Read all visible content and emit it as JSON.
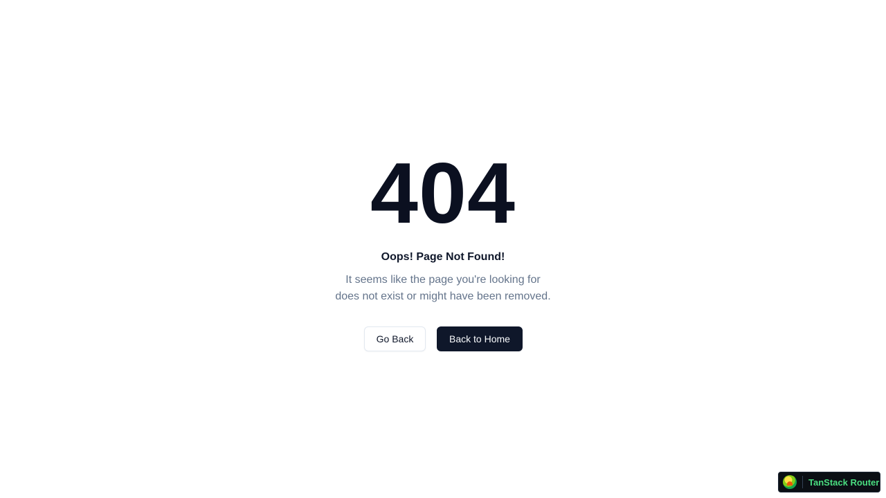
{
  "error": {
    "code": "404",
    "title": "Oops! Page Not Found!",
    "description_line1": "It seems like the page you're looking for",
    "description_line2": "does not exist or might have been removed."
  },
  "actions": {
    "go_back_label": "Go Back",
    "home_label": "Back to Home"
  },
  "devtools": {
    "label": "TanStack Router",
    "icon": "tanstack-router-logo-icon"
  },
  "colors": {
    "background": "#ffffff",
    "heading": "#0b1020",
    "muted_text": "#64748b",
    "primary_button": "#0f172a",
    "devtools_label": "#4ade80"
  }
}
